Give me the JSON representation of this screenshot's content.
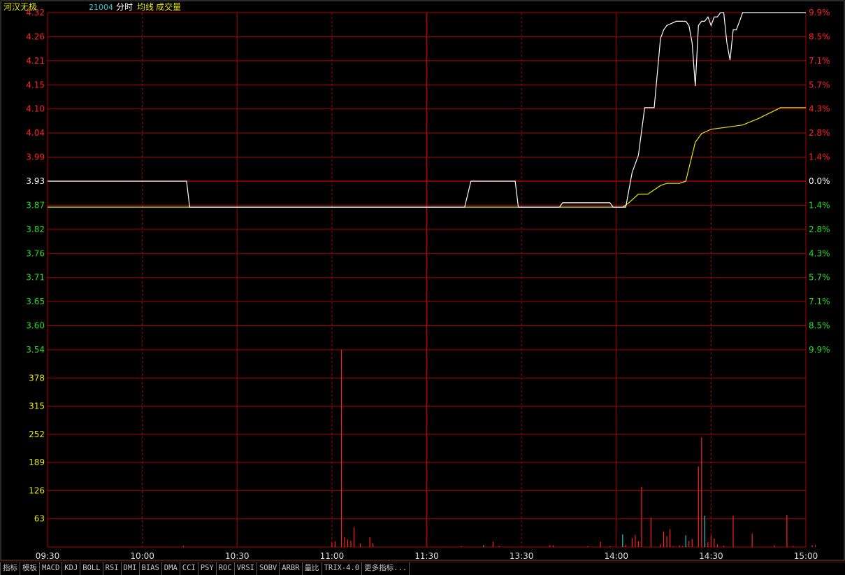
{
  "header": {
    "stock_name": "河汉无极",
    "stock_code": "21004",
    "indicators": [
      "分时",
      "均线",
      "成交量"
    ]
  },
  "chart_data": {
    "type": "line",
    "title": "河汉无极 21004",
    "price_ticks": [
      "4.32",
      "4.26",
      "4.21",
      "4.15",
      "4.10",
      "4.04",
      "3.99",
      "3.93",
      "3.87",
      "3.82",
      "3.76",
      "3.71",
      "3.65",
      "3.60",
      "3.54"
    ],
    "pct_ticks": [
      "9.9%",
      "8.5%",
      "7.1%",
      "5.7%",
      "4.3%",
      "2.8%",
      "1.4%",
      "0.0%",
      "1.4%",
      "2.8%",
      "4.3%",
      "5.7%",
      "7.1%",
      "8.5%",
      "9.9%"
    ],
    "volume_ticks": [
      "378",
      "315",
      "252",
      "189",
      "126",
      "63"
    ],
    "time_ticks": [
      "09:30",
      "10:00",
      "10:30",
      "11:00",
      "11:30",
      "13:30",
      "14:00",
      "14:30",
      "15:00"
    ],
    "pre_close": 3.93,
    "price_range": [
      3.54,
      4.32
    ],
    "volume_range": [
      0,
      441
    ],
    "price_line": [
      [
        0,
        3.93
      ],
      [
        44,
        3.93
      ],
      [
        45,
        3.87
      ],
      [
        132,
        3.87
      ],
      [
        134,
        3.93
      ],
      [
        148,
        3.93
      ],
      [
        149,
        3.87
      ],
      [
        162,
        3.87
      ],
      [
        163,
        3.88
      ],
      [
        178,
        3.88
      ],
      [
        179,
        3.87
      ],
      [
        183,
        3.87
      ],
      [
        185,
        3.95
      ],
      [
        187,
        3.99
      ],
      [
        189,
        4.1
      ],
      [
        190,
        4.1
      ],
      [
        192,
        4.1
      ],
      [
        194,
        4.26
      ],
      [
        195,
        4.28
      ],
      [
        196,
        4.29
      ],
      [
        199,
        4.3
      ],
      [
        201,
        4.3
      ],
      [
        202,
        4.3
      ],
      [
        203,
        4.29
      ],
      [
        204,
        4.25
      ],
      [
        205,
        4.15
      ],
      [
        206,
        4.29
      ],
      [
        207,
        4.3
      ],
      [
        208,
        4.3
      ],
      [
        209,
        4.31
      ],
      [
        210,
        4.29
      ],
      [
        211,
        4.31
      ],
      [
        212,
        4.31
      ],
      [
        213,
        4.32
      ],
      [
        214,
        4.32
      ],
      [
        215,
        4.25
      ],
      [
        216,
        4.21
      ],
      [
        217,
        4.28
      ],
      [
        218,
        4.28
      ],
      [
        219,
        4.3
      ],
      [
        220,
        4.32
      ],
      [
        240,
        4.32
      ]
    ],
    "avg_line": [
      [
        0,
        3.87
      ],
      [
        182,
        3.87
      ],
      [
        184,
        3.88
      ],
      [
        187,
        3.9
      ],
      [
        190,
        3.9
      ],
      [
        192,
        3.91
      ],
      [
        194,
        3.92
      ],
      [
        196,
        3.925
      ],
      [
        200,
        3.925
      ],
      [
        202,
        3.93
      ],
      [
        203,
        3.96
      ],
      [
        205,
        4.02
      ],
      [
        207,
        4.04
      ],
      [
        210,
        4.05
      ],
      [
        215,
        4.055
      ],
      [
        220,
        4.06
      ],
      [
        225,
        4.075
      ],
      [
        232,
        4.1
      ],
      [
        240,
        4.1
      ]
    ],
    "volume_bars": [
      [
        43,
        3,
        "red"
      ],
      [
        90,
        10,
        "red"
      ],
      [
        91,
        13,
        "red"
      ],
      [
        93,
        441,
        "red"
      ],
      [
        94,
        22,
        "red"
      ],
      [
        95,
        17,
        "red"
      ],
      [
        96,
        14,
        "red"
      ],
      [
        97,
        44,
        "red"
      ],
      [
        99,
        8,
        "red"
      ],
      [
        102,
        22,
        "red"
      ],
      [
        103,
        9,
        "red"
      ],
      [
        126,
        1,
        "red"
      ],
      [
        131,
        2,
        "red"
      ],
      [
        138,
        4,
        "cyan"
      ],
      [
        141,
        12,
        "red"
      ],
      [
        143,
        2,
        "red"
      ],
      [
        159,
        4,
        "red"
      ],
      [
        160,
        4,
        "red"
      ],
      [
        171,
        2,
        "red"
      ],
      [
        175,
        12,
        "red"
      ],
      [
        178,
        2,
        "red"
      ],
      [
        182,
        28,
        "cyan"
      ],
      [
        183,
        5,
        "red"
      ],
      [
        185,
        20,
        "red"
      ],
      [
        186,
        27,
        "red"
      ],
      [
        187,
        13,
        "red"
      ],
      [
        188,
        135,
        "red"
      ],
      [
        191,
        66,
        "red"
      ],
      [
        194,
        6,
        "red"
      ],
      [
        195,
        35,
        "red"
      ],
      [
        196,
        24,
        "red"
      ],
      [
        197,
        40,
        "red"
      ],
      [
        198,
        2,
        "red"
      ],
      [
        200,
        4,
        "red"
      ],
      [
        201,
        2,
        "red"
      ],
      [
        202,
        26,
        "cyan"
      ],
      [
        203,
        14,
        "red"
      ],
      [
        204,
        18,
        "red"
      ],
      [
        206,
        180,
        "red"
      ],
      [
        207,
        245,
        "red"
      ],
      [
        208,
        70,
        "cyan"
      ],
      [
        209,
        11,
        "red"
      ],
      [
        210,
        26,
        "red"
      ],
      [
        211,
        19,
        "red"
      ],
      [
        212,
        6,
        "red"
      ],
      [
        214,
        3,
        "red"
      ],
      [
        217,
        70,
        "red"
      ],
      [
        223,
        30,
        "red"
      ],
      [
        230,
        4,
        "red"
      ],
      [
        234,
        72,
        "red"
      ],
      [
        236,
        2,
        "red"
      ],
      [
        242,
        4,
        "red"
      ],
      [
        243,
        4,
        "red"
      ]
    ]
  },
  "tabs": [
    "指标",
    "模板",
    "MACD",
    "KDJ",
    "BOLL",
    "RSI",
    "DMI",
    "BIAS",
    "DMA",
    "CCI",
    "PSY",
    "ROC",
    "VRSI",
    "SOBV",
    "ARBR",
    "量比",
    "TRIX-4.0",
    "更多指标..."
  ],
  "colors": {
    "grid": "#b00000",
    "up": "#ff2020",
    "down": "#22dd22",
    "flat": "#ffffff",
    "volume_axis": "#e6e600",
    "price_line": "#ffffff",
    "avg_line": "#e6e600",
    "cyan": "#22cccc"
  }
}
